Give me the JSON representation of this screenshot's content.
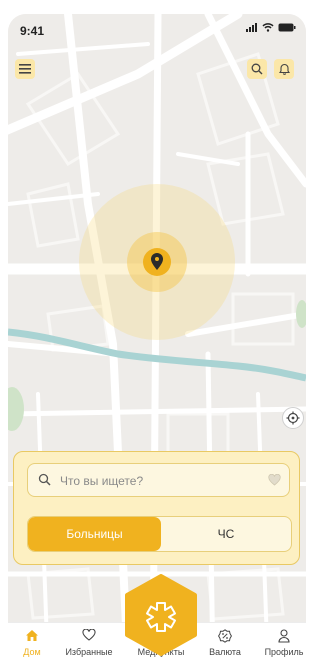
{
  "status_bar": {
    "time": "9:41"
  },
  "search": {
    "placeholder": "Что вы ищете?"
  },
  "segments": {
    "active_label": "Больницы",
    "inactive_label": "ЧС"
  },
  "tabs": [
    {
      "label": "Дом",
      "icon": "home-icon",
      "active": true
    },
    {
      "label": "Избранные",
      "icon": "heart-icon",
      "active": false
    },
    {
      "label": "Медпункты",
      "icon": "medical-hexagon-icon",
      "active": false
    },
    {
      "label": "Валюта",
      "icon": "percent-icon",
      "active": false
    },
    {
      "label": "Профиль",
      "icon": "person-icon",
      "active": false
    }
  ],
  "colors": {
    "accent": "#f0b21f",
    "accent_soft": "#fbe7a8",
    "panel": "#fdf0c2",
    "map_bg": "#eeece9",
    "river": "#a9d3d3",
    "pin": "#2b2b2b"
  }
}
